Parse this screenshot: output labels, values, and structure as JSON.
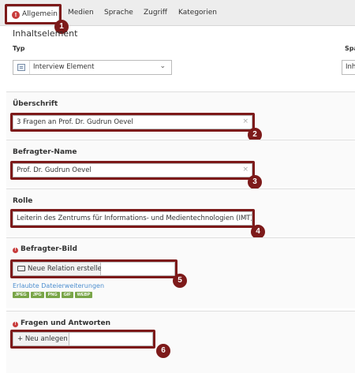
{
  "tabs": [
    "Allgemein",
    "Medien",
    "Sprache",
    "Zugriff",
    "Kategorien"
  ],
  "active_tab_warning": "!",
  "group_heading": "Inhaltselement",
  "type_field": {
    "label": "Typ",
    "value": "Interview Element"
  },
  "right_column": {
    "label": "Spa",
    "value": "Inh"
  },
  "headline": {
    "label": "Überschrift",
    "value": "3 Fragen an Prof. Dr. Gudrun Oevel"
  },
  "interviewee_name": {
    "label": "Befragter-Name",
    "value": "Prof. Dr. Gudrun Oevel"
  },
  "role": {
    "label": "Rolle",
    "value": "Leiterin des Zentrums für Informations- und Medientechnologien (IMT)"
  },
  "interviewee_image": {
    "label": "Befragter-Bild",
    "button": "Neue Relation erstellen",
    "allowed_link": "Erlaubte Dateierweiterungen",
    "extensions": [
      "JPEG",
      "JPG",
      "PNG",
      "GIF",
      "WEBP"
    ]
  },
  "qa": {
    "label": "Fragen und Antworten",
    "button": "+ Neu anlegen"
  },
  "clear_symbol": "×",
  "error_symbol": "!",
  "markers": [
    "1",
    "2",
    "3",
    "4",
    "5",
    "6"
  ],
  "colors": {
    "highlight": "#7d1a1a",
    "error": "#c83c3c",
    "badge": "#79a548",
    "link": "#4f8fcf"
  }
}
